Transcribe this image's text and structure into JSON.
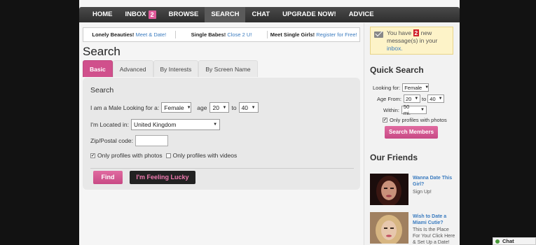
{
  "nav": {
    "items": [
      {
        "label": "HOME"
      },
      {
        "label": "INBOX",
        "badge": "2"
      },
      {
        "label": "BROWSE"
      },
      {
        "label": "SEARCH",
        "active": true
      },
      {
        "label": "CHAT"
      },
      {
        "label": "UPGRADE NOW!"
      },
      {
        "label": "ADVICE"
      }
    ]
  },
  "promo": [
    {
      "bold": "Lonely Beauties!",
      "link": "Meet & Date!"
    },
    {
      "bold": "Single Babes!",
      "link": "Close 2 U!"
    },
    {
      "bold": "Meet Single Girls!",
      "link": "Register for Free!"
    }
  ],
  "search": {
    "title": "Search",
    "tabs": [
      "Basic",
      "Advanced",
      "By Interests",
      "By Screen Name"
    ],
    "panel_title": "Search",
    "looking_label": "I am a Male Looking for a:",
    "gender_value": "Female",
    "age_label": "age",
    "age_from": "20",
    "age_to_label": "to",
    "age_to": "40",
    "location_label": "I'm Located in:",
    "location_value": "United Kingdom",
    "zip_label": "Zip/Postal code:",
    "zip_value": "",
    "photos_label": "Only profiles with photos",
    "videos_label": "Only profiles with videos",
    "find_label": "Find",
    "lucky_label": "I'm Feeling Lucky"
  },
  "sidebar": {
    "msg_prefix": "You have",
    "msg_count": "2",
    "msg_middle": "new message(s) in your",
    "msg_link": "inbox.",
    "msg_end": "",
    "quick_search_title": "Quick Search",
    "qs_looking_label": "Looking for:",
    "qs_gender": "Female",
    "qs_age_label": "Age From:",
    "qs_age_from": "20",
    "qs_to": "to",
    "qs_age_to": "40",
    "qs_within_label": "Within:",
    "qs_within": "50 mi.",
    "qs_photos_label": "Only profiles with photos",
    "qs_button": "Search Members",
    "friends_title": "Our Friends",
    "friends": [
      {
        "title": "Wanna Date This Girl?",
        "desc": "Sign Up!"
      },
      {
        "title": "Wish to Date a Miami Cutie?",
        "desc": "This Is the Place For You! Click Here & Set Up a Date!"
      }
    ]
  },
  "chat": {
    "label": "Chat"
  }
}
